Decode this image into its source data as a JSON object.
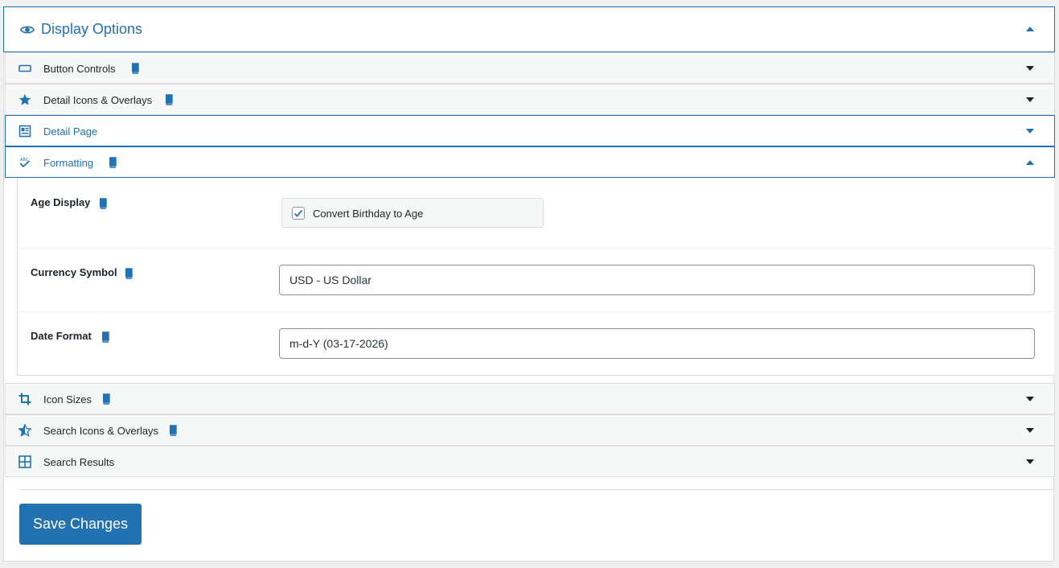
{
  "header": {
    "title": "Display Options",
    "icon": "eye-icon",
    "state": "expanded"
  },
  "sections": [
    {
      "label": "Button Controls",
      "icon": "button-icon",
      "has_docs": true,
      "state": "collapsed"
    },
    {
      "label": "Detail Icons & Overlays",
      "icon": "star-icon",
      "has_docs": true,
      "state": "collapsed"
    },
    {
      "label": "Detail Page",
      "icon": "page-icon",
      "has_docs": false,
      "state": "collapsed"
    },
    {
      "label": "Formatting",
      "icon": "spellcheck-icon",
      "has_docs": true,
      "state": "expanded"
    },
    {
      "label": "Icon Sizes",
      "icon": "crop-icon",
      "has_docs": true,
      "state": "collapsed"
    },
    {
      "label": "Search Icons & Overlays",
      "icon": "star-half-icon",
      "has_docs": true,
      "state": "collapsed"
    },
    {
      "label": "Search Results",
      "icon": "grid-icon",
      "has_docs": false,
      "state": "collapsed"
    }
  ],
  "formatting": {
    "age_display": {
      "label": "Age Display",
      "checkbox_label": "Convert Birthday to Age",
      "checked": true
    },
    "currency_symbol": {
      "label": "Currency Symbol",
      "value": "USD - US Dollar"
    },
    "date_format": {
      "label": "Date Format",
      "value": "m-d-Y (03-17-2026)"
    }
  },
  "footer": {
    "save_label": "Save Changes"
  },
  "colors": {
    "accent": "#2271b1",
    "text": "#1d2327",
    "border": "#dcdcde",
    "section_bg": "#f6f7f7"
  }
}
